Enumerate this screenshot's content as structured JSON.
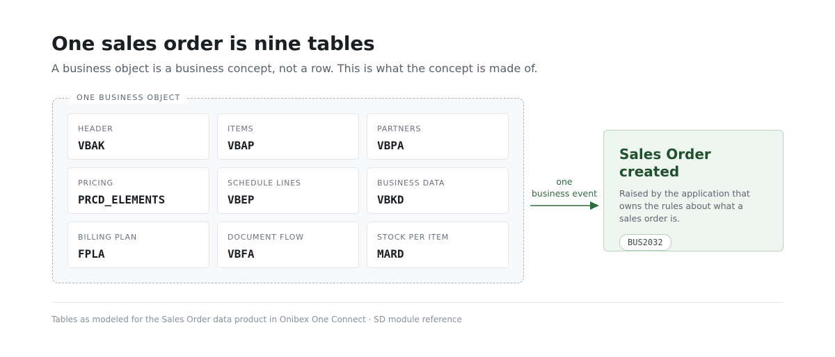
{
  "header": {
    "title": "One sales order is nine tables",
    "subtitle": "A business object is a business concept, not a row. This is what the concept is made of."
  },
  "object": {
    "label": "ONE BUSINESS OBJECT",
    "tables": [
      {
        "label": "HEADER",
        "code": "VBAK"
      },
      {
        "label": "ITEMS",
        "code": "VBAP"
      },
      {
        "label": "PARTNERS",
        "code": "VBPA"
      },
      {
        "label": "PRICING",
        "code": "PRCD_ELEMENTS"
      },
      {
        "label": "SCHEDULE LINES",
        "code": "VBEP"
      },
      {
        "label": "BUSINESS DATA",
        "code": "VBKD"
      },
      {
        "label": "BILLING PLAN",
        "code": "FPLA"
      },
      {
        "label": "DOCUMENT FLOW",
        "code": "VBFA"
      },
      {
        "label": "STOCK PER ITEM",
        "code": "MARD"
      }
    ]
  },
  "connector": {
    "line1": "one",
    "line2": "business event"
  },
  "event": {
    "title": "Sales Order created",
    "description": "Raised by the application that owns the rules about what a sales order is.",
    "badge": "BUS2032"
  },
  "footer": {
    "note": "Tables as modeled for the Sales Order data product in Onibex One Connect · SD module reference"
  },
  "colors": {
    "accent_green": "#2f6b3f",
    "event_bg": "#eef6f0",
    "dashed_border": "#a9b1bc"
  }
}
